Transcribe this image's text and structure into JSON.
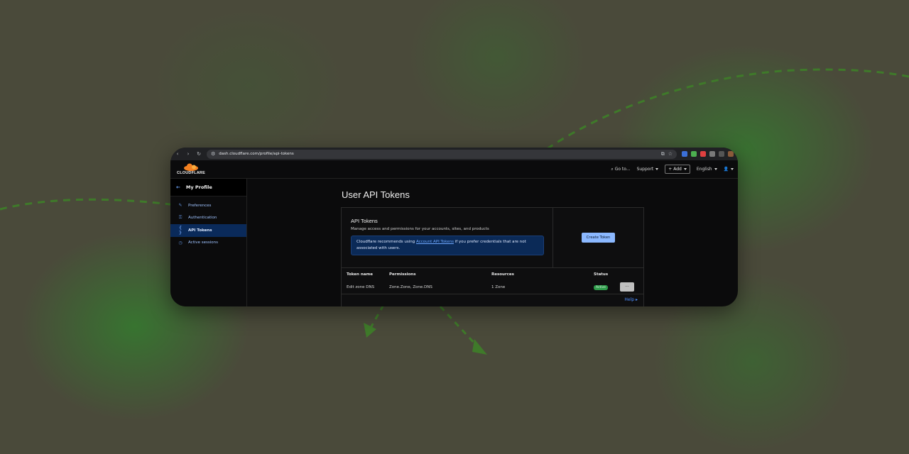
{
  "browser": {
    "url": "dash.cloudflare.com/profile/api-tokens"
  },
  "header": {
    "logo_text": "CLOUDFLARE",
    "goto_label": "Go to...",
    "support_label": "Support",
    "add_label": "+ Add",
    "language_label": "English"
  },
  "sidebar": {
    "title": "My Profile",
    "items": [
      {
        "label": "Preferences",
        "icon": "pencil-icon",
        "active": false
      },
      {
        "label": "Authentication",
        "icon": "key-icon",
        "active": false
      },
      {
        "label": "API Tokens",
        "icon": "braces-icon",
        "active": true
      },
      {
        "label": "Active sessions",
        "icon": "clock-icon",
        "active": false
      }
    ]
  },
  "main": {
    "page_title": "User API Tokens",
    "card": {
      "title": "API Tokens",
      "description": "Manage access and permissions for your accounts, sites, and products",
      "notice_before": "Cloudflare recommends using ",
      "notice_link": "Account API Tokens",
      "notice_after": " if you prefer credentials that are not associated with users.",
      "create_button": "Create Token"
    },
    "table": {
      "columns": [
        "Token name",
        "Permissions",
        "Resources",
        "Status"
      ],
      "rows": [
        {
          "name": "Edit zone DNS",
          "permissions": "Zone.Zone, Zone.DNS",
          "resources": "1 Zone",
          "status": "Active"
        }
      ]
    },
    "more_button": "···",
    "help_label": "Help"
  },
  "colors": {
    "accent": "#6ea8ff",
    "active_nav_bg": "#0a2a5a",
    "status_active": "#2e9b4a",
    "brand_orange": "#f38020"
  }
}
